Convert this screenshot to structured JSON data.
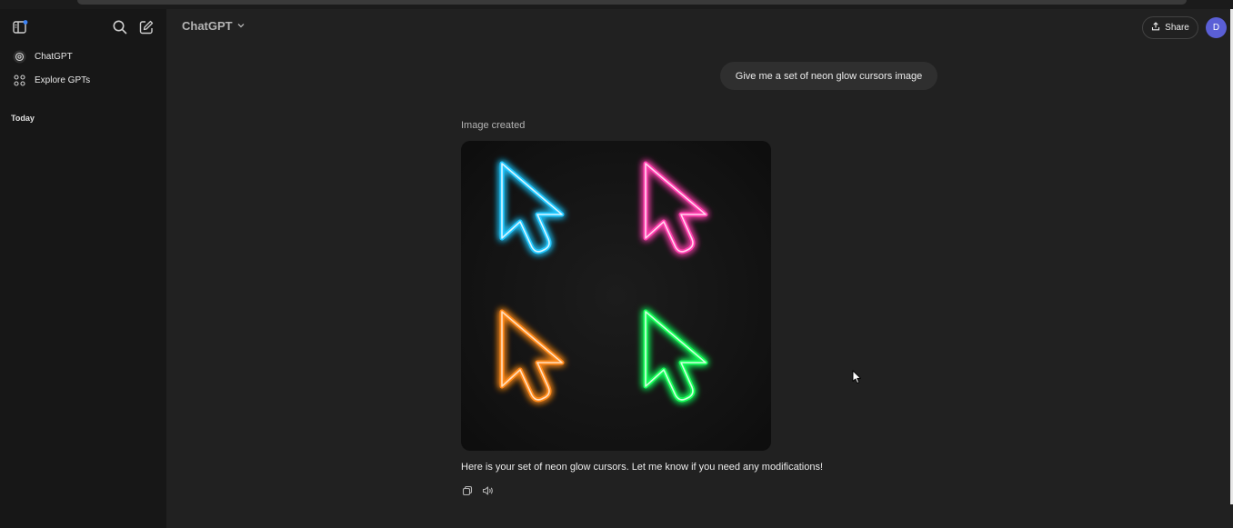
{
  "sidebar": {
    "items": [
      {
        "label": "ChatGPT",
        "icon": "openai-logo-icon"
      },
      {
        "label": "Explore GPTs",
        "icon": "grid-icon"
      }
    ],
    "section_title": "Today"
  },
  "header": {
    "model_label": "ChatGPT",
    "share_label": "Share",
    "avatar_initial": "D"
  },
  "conversation": {
    "user_message": "Give me a set of neon glow cursors image",
    "image_caption": "Image created",
    "assistant_reply": "Here is your set of neon glow cursors. Let me know if you need any modifications!"
  },
  "neon_colors": {
    "blue": "#22c8ff",
    "pink": "#ff3fae",
    "orange": "#ff8a1a",
    "green": "#19ff5a"
  },
  "accent_colors": {
    "avatar": "#5a5fd6",
    "sidebar_notify_dot": "#3b82f6"
  }
}
